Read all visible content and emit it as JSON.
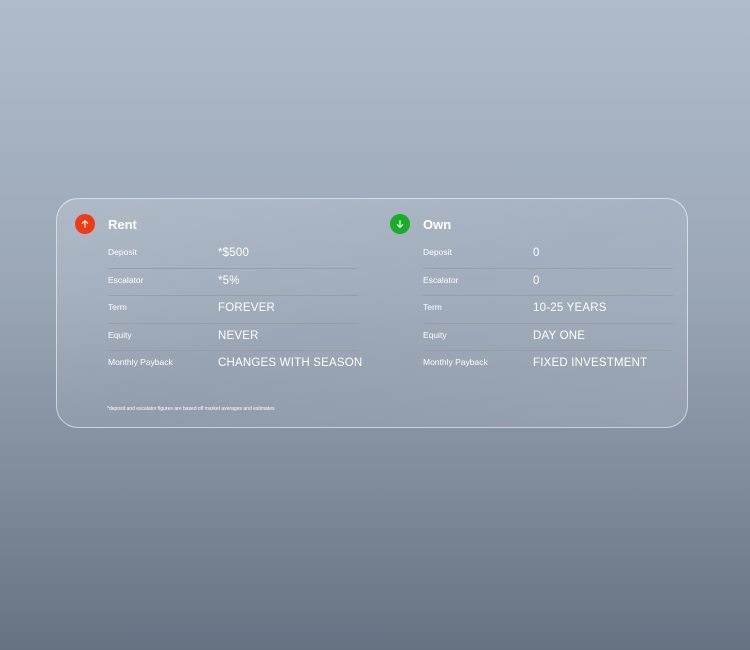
{
  "rent": {
    "title": "Rent",
    "icon": "arrow-up-icon",
    "color": "#f03a17",
    "rows": [
      {
        "label": "Deposit",
        "value": "*$500"
      },
      {
        "label": "Escalator",
        "value": "*5%"
      },
      {
        "label": "Term",
        "value": "FOREVER"
      },
      {
        "label": "Equity",
        "value": "NEVER"
      },
      {
        "label": "Monthly Payback",
        "value": "CHANGES WITH SEASON"
      }
    ]
  },
  "own": {
    "title": "Own",
    "icon": "arrow-down-icon",
    "color": "#1aab2a",
    "rows": [
      {
        "label": "Deposit",
        "value": "0"
      },
      {
        "label": "Escalator",
        "value": "0"
      },
      {
        "label": "Term",
        "value": "10-25 YEARS"
      },
      {
        "label": "Equity",
        "value": "DAY ONE"
      },
      {
        "label": "Monthly Payback",
        "value": "FIXED INVESTMENT"
      }
    ]
  },
  "footnote": "*deposit and escalator figures are based off market averages and estimates"
}
